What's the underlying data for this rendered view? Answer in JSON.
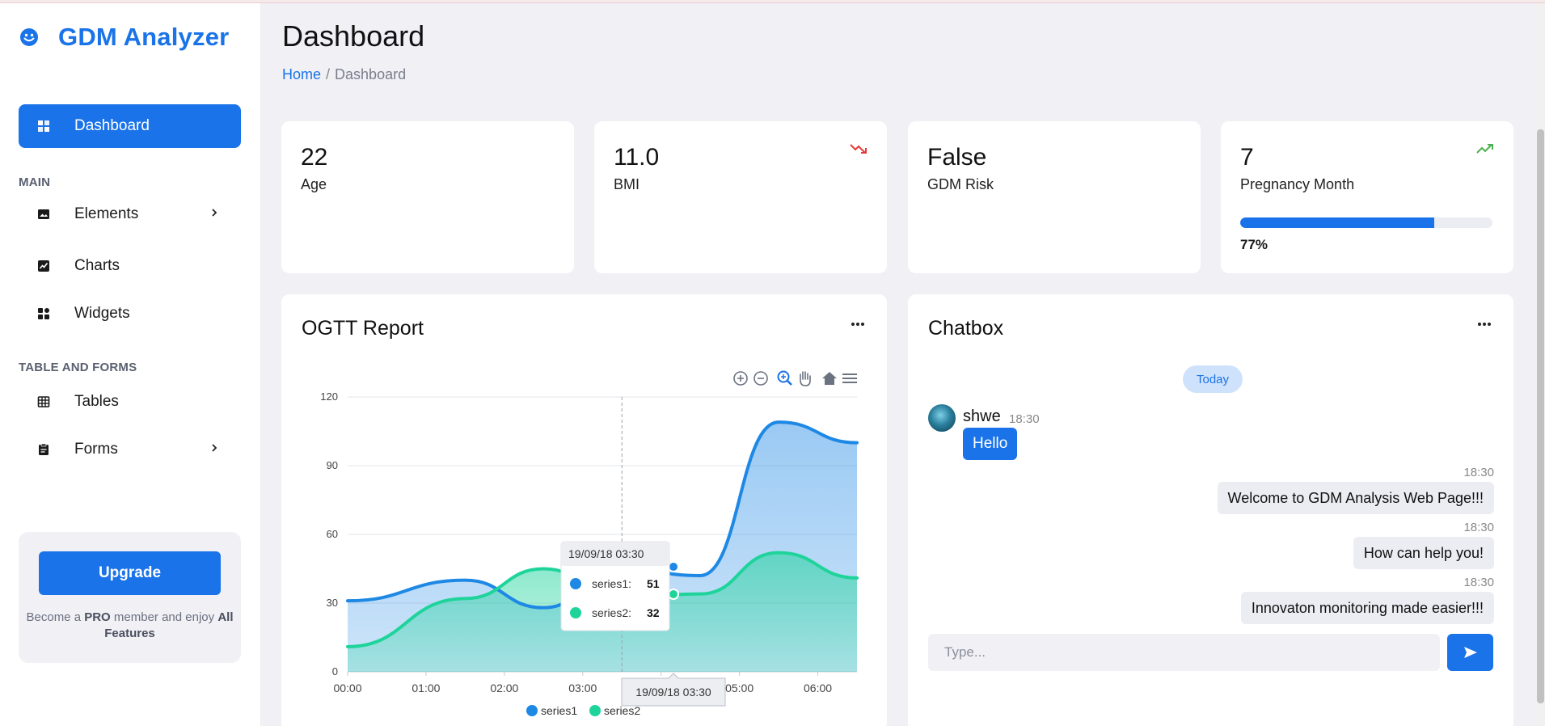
{
  "brand": {
    "name": "GDM Analyzer",
    "icon": "smiley-icon"
  },
  "sidebar": {
    "active_item": {
      "label": "Dashboard",
      "icon": "grid-icon"
    },
    "section_main": "MAIN",
    "main_items": [
      {
        "label": "Elements",
        "icon": "image-icon",
        "has_submenu": true
      },
      {
        "label": "Charts",
        "icon": "chart-icon",
        "has_submenu": false
      },
      {
        "label": "Widgets",
        "icon": "widgets-icon",
        "has_submenu": false
      }
    ],
    "section_tables": "TABLE AND FORMS",
    "table_items": [
      {
        "label": "Tables",
        "icon": "table-icon",
        "has_submenu": false
      },
      {
        "label": "Forms",
        "icon": "clipboard-icon",
        "has_submenu": true
      }
    ],
    "upgrade": {
      "button": "Upgrade",
      "text_pre": "Become a ",
      "text_bold1": "PRO",
      "text_mid": " member and enjoy ",
      "text_bold2": "All Features"
    }
  },
  "header": {
    "title": "Dashboard",
    "breadcrumb": {
      "home": "Home",
      "separator": "/",
      "current": "Dashboard"
    }
  },
  "stats": [
    {
      "value": "22",
      "label": "Age"
    },
    {
      "value": "11.0",
      "label": "BMI",
      "trend": "down",
      "trend_color": "#e53935"
    },
    {
      "value": "False",
      "label": "GDM Risk"
    },
    {
      "value": "7",
      "label": "Pregnancy Month",
      "trend": "up",
      "trend_color": "#4caf50",
      "progress": 77,
      "progress_label": "77%"
    }
  ],
  "ogtt": {
    "title": "OGTT Report",
    "toolbar": [
      "zoom-in-icon",
      "zoom-out-icon",
      "zoom-select-icon",
      "pan-hand-icon",
      "home-icon",
      "menu-icon"
    ],
    "tooltip": {
      "title": "19/09/18 03:30",
      "rows": [
        {
          "name": "series1",
          "value": "51"
        },
        {
          "name": "series2",
          "value": "32"
        }
      ]
    },
    "xaxis_tooltip": "19/09/18 03:30"
  },
  "chart_data": {
    "type": "area",
    "x": [
      "00:00",
      "01:00",
      "02:00",
      "03:00",
      "04:00",
      "05:00",
      "06:00"
    ],
    "x_ticks": [
      "00:00",
      "01:00",
      "02:00",
      "03:00",
      "04:00",
      "05:00",
      "06:00"
    ],
    "yticks": [
      0,
      30,
      60,
      90,
      120
    ],
    "ylim": [
      0,
      120
    ],
    "xlim_hours": [
      0,
      6.5
    ],
    "series": [
      {
        "name": "series1",
        "color": "#1e88e5",
        "points": [
          [
            0,
            31
          ],
          [
            1.5,
            40
          ],
          [
            2.5,
            28
          ],
          [
            3.5,
            45
          ],
          [
            4.5,
            42
          ],
          [
            5.5,
            109
          ],
          [
            6.5,
            100
          ]
        ]
      },
      {
        "name": "series2",
        "color": "#1ed49a",
        "points": [
          [
            0,
            11
          ],
          [
            1.5,
            32
          ],
          [
            2.5,
            45
          ],
          [
            3.5,
            32
          ],
          [
            4.5,
            34
          ],
          [
            5.5,
            52
          ],
          [
            6.5,
            41
          ]
        ]
      }
    ],
    "grid": true,
    "legend": "bottom-center",
    "crosshair_x": 3.5
  },
  "chat": {
    "title": "Chatbox",
    "day_badge": "Today",
    "incoming": {
      "sender": "shwe",
      "time": "18:30",
      "text": "Hello"
    },
    "outgoing": [
      {
        "time": "18:30",
        "text": "Welcome to GDM Analysis Web Page!!!"
      },
      {
        "time": "18:30",
        "text": "How can help you!"
      },
      {
        "time": "18:30",
        "text": "Innovaton monitoring made easier!!!"
      }
    ],
    "input_placeholder": "Type...",
    "send_icon": "send-icon"
  },
  "colors": {
    "accent": "#1a73e8",
    "background": "#f1f0f5",
    "card": "#ffffff"
  }
}
